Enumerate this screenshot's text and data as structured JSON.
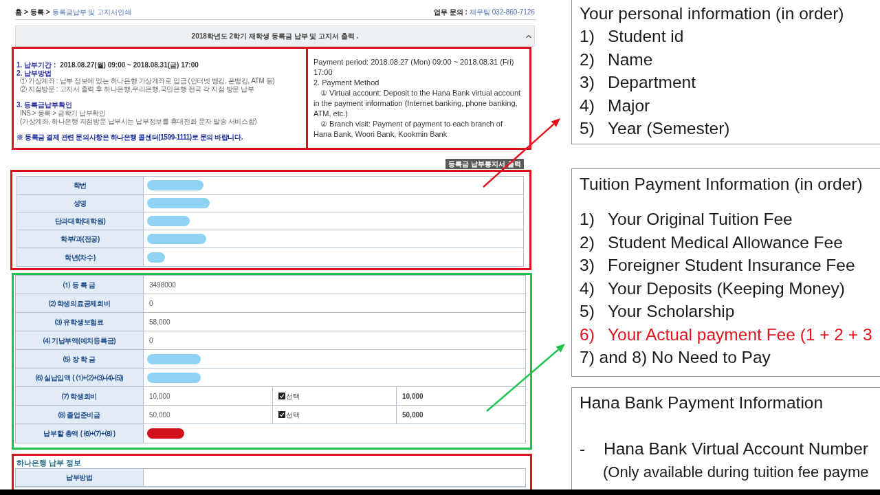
{
  "breadcrumb": {
    "separator": ">",
    "items": [
      {
        "text": "홈",
        "current": false
      },
      {
        "text": "등록",
        "current": false
      },
      {
        "text": "등록금납부 및 고지서인쇄",
        "current": true
      }
    ]
  },
  "contact": {
    "label": "업무 문의 :",
    "value": "재무팀 032-860-7126"
  },
  "panel": {
    "title": "2018학년도 2학기 재학생 등록금 납부 및 고지서 출력 ."
  },
  "notice": {
    "color": "#d9141c",
    "groups": [
      {
        "lines": [
          {
            "kind": "heading",
            "text": "1. 납부기간 :",
            "value": "2018.08.27(월) 09:00 ~ 2018.08.31(금) 17:00"
          },
          {
            "kind": "heading",
            "text": "2. 납부방법"
          },
          {
            "kind": "detail",
            "text": "① 가상계좌 : 납부 정보에 있는 하나은행 가상계좌로 입금 (인터넷 뱅킹, 폰뱅킹, ATM 등)"
          },
          {
            "kind": "detail",
            "text": "② 지점방문 : 고지서 출력 후 하나은행,우리은행,국민은행 전국 각 지점 방문 납부"
          }
        ]
      },
      {
        "lines": [
          {
            "kind": "heading",
            "text": "3. 등록금납부확인"
          },
          {
            "kind": "detail",
            "text": "INS > 등록 > 금학기 납부확인"
          },
          {
            "kind": "detail",
            "text": "(가상계좌, 하나은행 지점방문 납부시는 납부정보를 휴대전화 문자 발송 서비스함)"
          }
        ]
      },
      {
        "lines": [
          {
            "kind": "warning",
            "text": "※ 등록금 결제 관련 문의사항은 하나은행 콜센터(1599-1111)로 문의 바랍니다."
          }
        ]
      }
    ]
  },
  "translation": {
    "color": "#d9141c",
    "paragraphs": [
      {
        "kind": "plain",
        "text": "Payment period: 2018.08.27 (Mon) 09:00 ~ 2018.08.31 (Fri) 17:00"
      },
      {
        "kind": "plain",
        "text": "2. Payment Method"
      },
      {
        "kind": "indented",
        "text": "① Virtual account: Deposit to the Hana Bank virtual account in the payment information (Internet banking, phone banking, ATM, etc.)"
      },
      {
        "kind": "indented",
        "text": "② Branch visit: Payment of payment to each branch of Hana Bank, Woori Bank, Kookmin Bank"
      }
    ]
  },
  "print_button": {
    "label": "등록금 납부통지서 출력"
  },
  "student_table": {
    "color": "#d9141c",
    "rows": [
      {
        "label": "학번",
        "kind": "redacted",
        "color": "#8ed3f3"
      },
      {
        "label": "성명",
        "kind": "redacted",
        "color": "#8ed3f3"
      },
      {
        "label": "단과대학(대학원)",
        "kind": "redacted",
        "color": "#8ed3f3"
      },
      {
        "label": "학부/과(전공)",
        "kind": "redacted",
        "color": "#8ed3f3"
      },
      {
        "label": "학년(차수)",
        "kind": "redacted",
        "color": "#8ed3f3"
      }
    ]
  },
  "fee_table": {
    "color": "#1fbf4f",
    "rows": [
      {
        "label": "⑴ 등 록 금",
        "kind": "text",
        "value": "3498000"
      },
      {
        "label": "⑵ 학생의료공제회비",
        "kind": "text",
        "value": "0"
      },
      {
        "label": "⑶ 유학생보험료",
        "kind": "text",
        "value": "58,000"
      },
      {
        "label": "⑷ 기납부액(예치등록금)",
        "kind": "text",
        "value": "0"
      },
      {
        "label": "⑸ 장 학 금",
        "kind": "redacted",
        "color": "#8ed3f3"
      },
      {
        "label": "⑹ 실납입액 ( ⑴+⑵+⑶-⑷-⑸)",
        "kind": "redacted",
        "color": "#8ed3f3"
      },
      {
        "label": "⑺ 학생회비",
        "kind": "optional",
        "value": "10,000",
        "option": "선택",
        "checked": true,
        "amount": "10,000"
      },
      {
        "label": "⑻ 졸업준비금",
        "kind": "optional",
        "value": "50,000",
        "option": "선택",
        "checked": true,
        "amount": "50,000"
      },
      {
        "label": "납부할 총액 ( ⑹+⑺+⑻ )",
        "kind": "redacted",
        "color": "#d0101b"
      }
    ]
  },
  "hana_section": {
    "color": "#d9141c",
    "title": "하나은행 납부 정보",
    "rows": [
      {
        "label": "납부방법"
      }
    ]
  },
  "arrows": [
    {
      "color": "#e0141e"
    },
    {
      "color": "#1fc44e"
    }
  ],
  "notes": [
    {
      "title": "Your personal information (in order)",
      "items": [
        {
          "kind": "numbered",
          "number": "1)",
          "text": "Student id",
          "emphasis": false
        },
        {
          "kind": "numbered",
          "number": "2)",
          "text": "Name",
          "emphasis": false
        },
        {
          "kind": "numbered",
          "number": "3)",
          "text": "Department",
          "emphasis": false
        },
        {
          "kind": "numbered",
          "number": "4)",
          "text": "Major",
          "emphasis": false
        },
        {
          "kind": "numbered",
          "number": "5)",
          "text": "Year (Semester)",
          "emphasis": false
        }
      ]
    },
    {
      "title": "Tuition Payment Information (in order)",
      "items": [
        {
          "kind": "numbered",
          "number": "1)",
          "text": "Your Original Tuition Fee",
          "emphasis": false
        },
        {
          "kind": "numbered",
          "number": "2)",
          "text": "Student Medical Allowance Fee",
          "emphasis": false
        },
        {
          "kind": "numbered",
          "number": "3)",
          "text": "Foreigner Student Insurance Fee",
          "emphasis": false
        },
        {
          "kind": "numbered",
          "number": "4)",
          "text": "Your Deposits (Keeping Money)",
          "emphasis": false
        },
        {
          "kind": "numbered",
          "number": "5)",
          "text": "Your Scholarship",
          "emphasis": false
        },
        {
          "kind": "numbered",
          "number": "6)",
          "text": "Your Actual payment Fee (1 + 2 + 3",
          "emphasis": true
        },
        {
          "kind": "plain",
          "text": "7) and 8) No Need to Pay",
          "emphasis": false
        }
      ]
    },
    {
      "title": "Hana Bank Payment Information",
      "items": [
        {
          "kind": "bullet",
          "number": "-",
          "text": "Hana Bank Virtual Account Number",
          "emphasis": false
        },
        {
          "kind": "note",
          "text": "(Only available during tuition fee payme",
          "emphasis": false
        }
      ]
    }
  ]
}
